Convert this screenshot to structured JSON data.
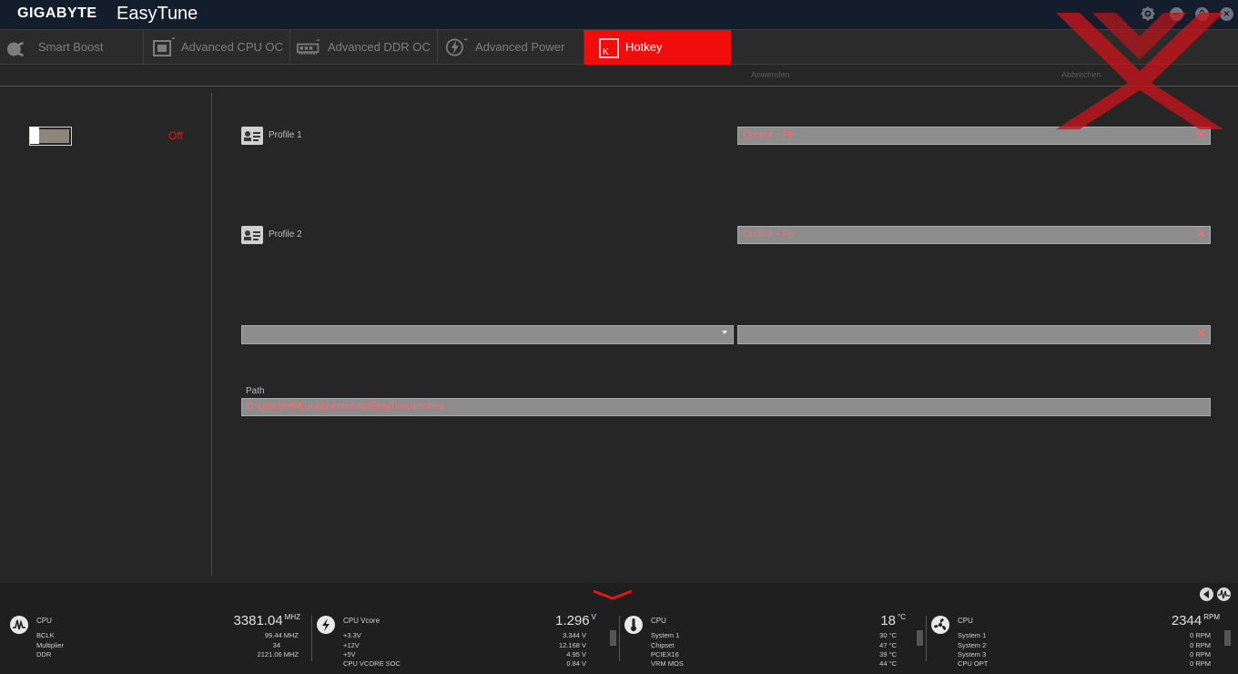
{
  "window": {
    "brand": "GIGABYTE",
    "app_title": "EasyTune",
    "controls": {
      "settings": "gear-icon",
      "minimize": "−",
      "maximize": "^",
      "close": "×"
    }
  },
  "tabs": [
    {
      "label": "Smart Boost",
      "icon": "smart-boost-icon",
      "active": false
    },
    {
      "label": "Advanced CPU OC",
      "icon": "cpu-chip-icon",
      "active": false
    },
    {
      "label": "Advanced DDR OC",
      "icon": "memory-module-icon",
      "active": false
    },
    {
      "label": "Advanced Power",
      "icon": "lightning-icon",
      "active": false
    },
    {
      "label": "Hotkey",
      "icon": "key-k-icon",
      "active": true
    }
  ],
  "actions": {
    "apply": "Anwenden",
    "cancel": "Abbrechen"
  },
  "hotkey": {
    "toggle_state": "Off",
    "profiles": [
      {
        "label": "Profile 1",
        "hotkey": "Control + F5"
      },
      {
        "label": "Profile 2",
        "hotkey": "Control + F6"
      }
    ],
    "extra_profile": {
      "selected": "",
      "hotkey": ""
    },
    "path_label": "Path",
    "path_value": "C:\\Users\\HWLuxx\\Documents\\EasyTune\\Profiles"
  },
  "monitor": {
    "frequency": {
      "title": "CPU",
      "value": "3381.04",
      "unit": "MHZ",
      "rows": [
        {
          "label": "BCLK",
          "value": "99.44 MHZ"
        },
        {
          "label": "Multiplier",
          "value": "34"
        },
        {
          "label": "DDR",
          "value": "2121.06 MHZ"
        }
      ]
    },
    "voltage": {
      "title": "CPU Vcore",
      "value": "1.296",
      "unit": "V",
      "rows": [
        {
          "label": "+3.3V",
          "value": "3.344 V"
        },
        {
          "label": "+12V",
          "value": "12.168 V"
        },
        {
          "label": "+5V",
          "value": "4.95 V"
        },
        {
          "label": "CPU VCORE SOC",
          "value": "0.84 V"
        }
      ]
    },
    "temperature": {
      "title": "CPU",
      "value": "18",
      "unit": "°C",
      "rows": [
        {
          "label": "System 1",
          "value": "30 °C"
        },
        {
          "label": "Chipset",
          "value": "47 °C"
        },
        {
          "label": "PCIEX16",
          "value": "39 °C"
        },
        {
          "label": "VRM MOS",
          "value": "44 °C"
        }
      ]
    },
    "fan": {
      "title": "CPU",
      "value": "2344",
      "unit": "RPM",
      "rows": [
        {
          "label": "System 1",
          "value": "0 RPM"
        },
        {
          "label": "System 2",
          "value": "0 RPM"
        },
        {
          "label": "System 3",
          "value": "0 RPM"
        },
        {
          "label": "CPU OPT",
          "value": "0 RPM"
        }
      ]
    }
  },
  "colors": {
    "accent": "#f20d0d",
    "titlebar": "#141d2b",
    "field": "#8d8d8d",
    "field_text": "#ff6a6a"
  }
}
